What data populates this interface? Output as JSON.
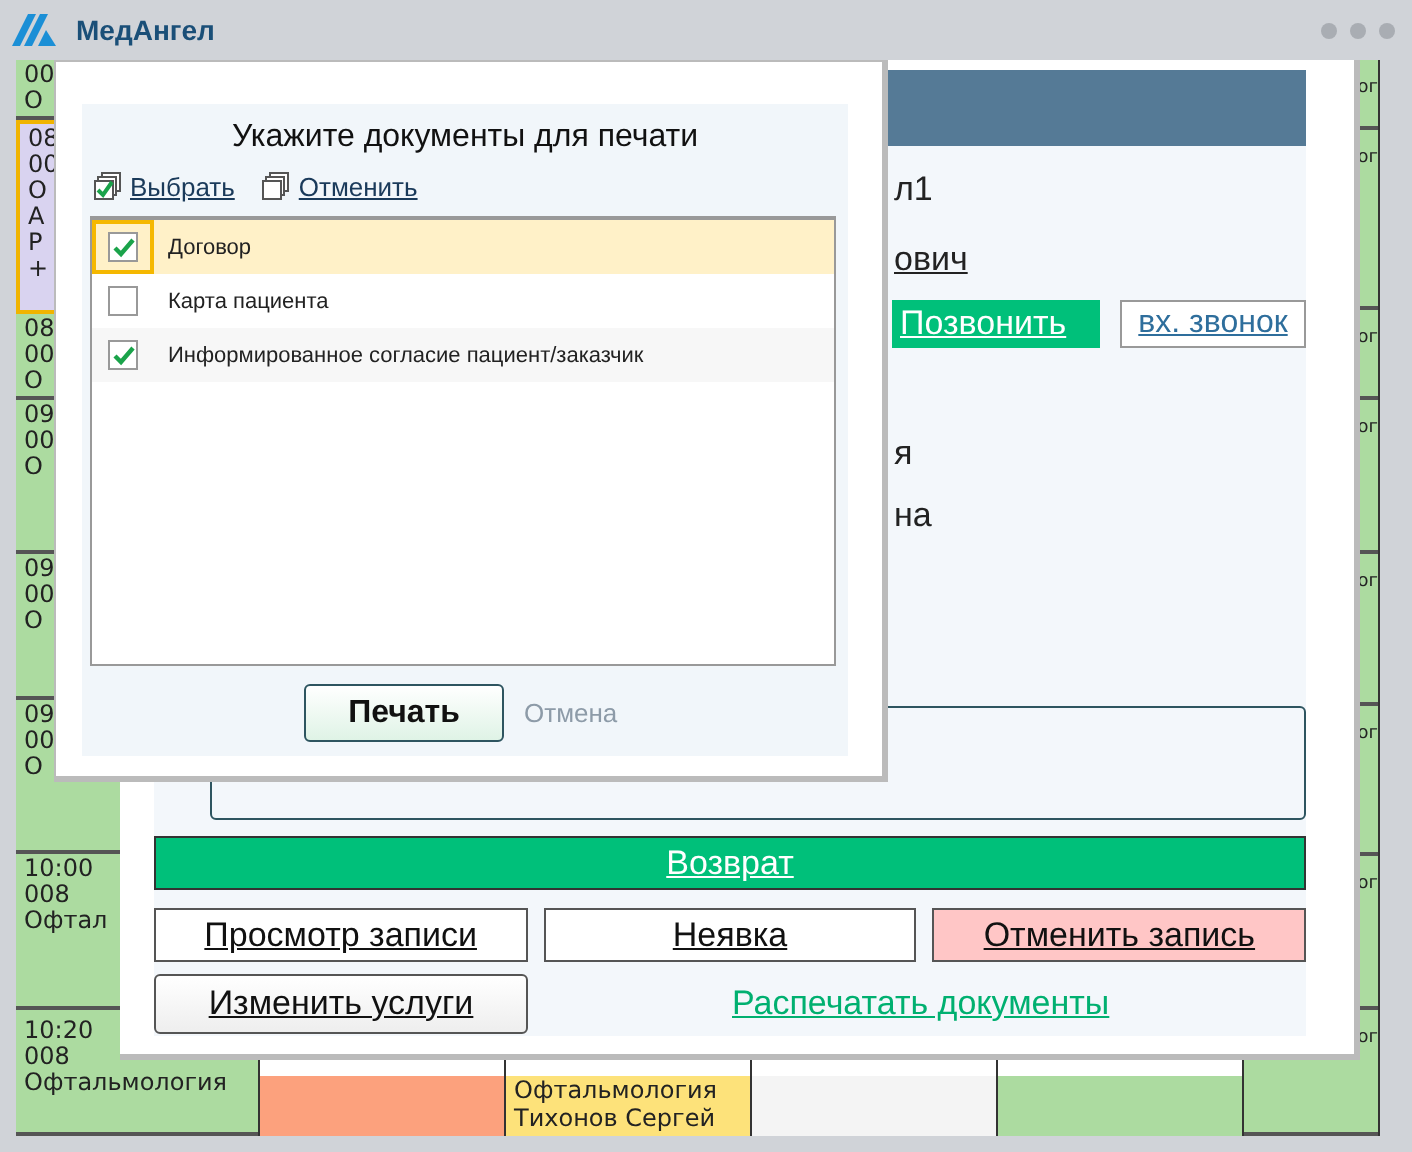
{
  "app": {
    "title": "МедАнгел"
  },
  "schedule": {
    "columns": [
      {
        "kind": "full",
        "cells": [
          {
            "lines": [
              "00",
              "О"
            ],
            "color": "#acdba0",
            "selected": false
          },
          {
            "lines": [
              "08",
              "00",
              "О",
              "А",
              "Р",
              "+"
            ],
            "color": "#d9d3f0",
            "selected": true
          },
          {
            "lines": [
              "08",
              "00",
              "О"
            ],
            "color": "#acdba0",
            "selected": false
          },
          {
            "lines": [
              "09",
              "00",
              "О"
            ],
            "color": "#acdba0",
            "selected": false
          },
          {
            "lines": [
              "09",
              "00",
              "О"
            ],
            "color": "#acdba0",
            "selected": false
          },
          {
            "lines": [
              "09",
              "00",
              "О"
            ],
            "color": "#acdba0",
            "selected": false
          },
          {
            "lines": [
              "10:00",
              "008",
              "Офтал"
            ],
            "color": "#acdba0",
            "selected": false
          },
          {
            "lines": [
              "10:20",
              "008",
              "Офтальмология"
            ],
            "color": "#acdba0",
            "selected": false
          }
        ]
      },
      {
        "kind": "bottom",
        "cells": [
          {
            "color": "#fca17d",
            "selected": false
          }
        ]
      },
      {
        "kind": "bottom",
        "cells": [
          {
            "lines": [
              "Офтальмология",
              "Тихонов Сергей"
            ],
            "color": "#fde27a",
            "selected": false
          }
        ]
      },
      {
        "kind": "bottom",
        "cells": [
          {
            "color": "#f4f4f4",
            "selected": false
          }
        ]
      },
      {
        "kind": "bottom",
        "cells": [
          {
            "color": "#acdba0",
            "selected": false
          }
        ]
      },
      {
        "kind": "full",
        "cells": [
          {
            "lines": [
              "ог"
            ],
            "color": "#acdba0",
            "selected": false
          },
          {
            "lines": [
              "ог"
            ],
            "color": "#acdba0",
            "selected": false
          },
          {
            "lines": [
              "ог"
            ],
            "color": "#acdba0",
            "selected": false
          },
          {
            "lines": [
              "ог"
            ],
            "color": "#acdba0",
            "selected": false
          },
          {
            "lines": [
              "ог"
            ],
            "color": "#acdba0",
            "selected": false
          },
          {
            "lines": [
              "ог"
            ],
            "color": "#acdba0",
            "selected": false
          },
          {
            "lines": [
              "ог"
            ],
            "color": "#acdba0",
            "selected": false
          },
          {
            "lines": [
              "ог"
            ],
            "color": "#acdba0",
            "selected": false
          }
        ]
      }
    ]
  },
  "appointment": {
    "name_fragments": [
      {
        "text": "л1",
        "kind": "plain"
      },
      {
        "text": "ович",
        "kind": "link"
      }
    ],
    "call_button": "Позвонить",
    "incoming_call_button": "вх. звонок",
    "detail_fragments": [
      "я",
      "на"
    ],
    "return_button": "Возврат",
    "actions": [
      {
        "label": "Просмотр записи",
        "kind": "plain"
      },
      {
        "label": "Неявка",
        "kind": "plain"
      },
      {
        "label": "Отменить запись",
        "kind": "danger"
      }
    ],
    "change_services_button": "Изменить услуги",
    "print_documents_link": "Распечатать документы"
  },
  "print_dialog": {
    "title": "Укажите документы для печати",
    "select_all": "Выбрать",
    "deselect_all": "Отменить",
    "documents": [
      {
        "name": "Договор",
        "checked": true,
        "selected": true
      },
      {
        "name": "Карта пациента",
        "checked": false,
        "selected": false
      },
      {
        "name": "Информированное согласие пациент/заказчик",
        "checked": true,
        "selected": false
      }
    ],
    "print_button": "Печать",
    "cancel_button": {
      "label": "Отмена",
      "disabled": true
    }
  }
}
